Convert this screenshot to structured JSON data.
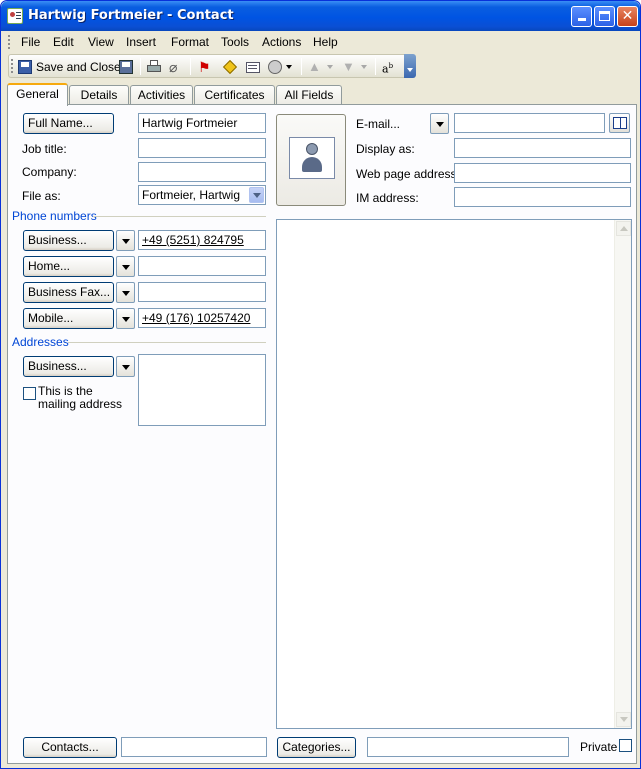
{
  "window": {
    "title": "Hartwig Fortmeier - Contact"
  },
  "menu": {
    "file": "File",
    "edit": "Edit",
    "view": "View",
    "insert": "Insert",
    "format": "Format",
    "tools": "Tools",
    "actions": "Actions",
    "help": "Help"
  },
  "toolbar": {
    "save_close": "Save and Close",
    "icons": [
      "save-icon",
      "print-icon",
      "attach-icon",
      "flag-icon",
      "tag-icon",
      "card-icon",
      "globe-icon",
      "previous-item-icon",
      "next-item-icon",
      "spelling-icon"
    ]
  },
  "tabs": [
    "General",
    "Details",
    "Activities",
    "Certificates",
    "All Fields"
  ],
  "general": {
    "full_name_button": "Full Name...",
    "full_name_value": "Hartwig Fortmeier",
    "job_title_label": "Job title:",
    "job_title_value": "",
    "company_label": "Company:",
    "company_value": "",
    "file_as_label": "File as:",
    "file_as_value": "Fortmeier, Hartwig",
    "phone_group": "Phone numbers",
    "phones": [
      {
        "label": "Business...",
        "value": "+49 (5251) 824795"
      },
      {
        "label": "Home...",
        "value": ""
      },
      {
        "label": "Business Fax...",
        "value": ""
      },
      {
        "label": "Mobile...",
        "value": "+49 (176) 10257420"
      }
    ],
    "address_group": "Addresses",
    "address_button": "Business...",
    "address_value": "",
    "mailing_checkbox_label": "This is the mailing address",
    "mailing_checked": false,
    "email_label": "E-mail...",
    "email_value": "",
    "display_as_label": "Display as:",
    "display_as_value": "",
    "web_page_label": "Web page address:",
    "web_page_value": "",
    "im_label": "IM address:",
    "im_value": "",
    "notes_value": "",
    "contacts_button": "Contacts...",
    "contacts_value": "",
    "categories_button": "Categories...",
    "categories_value": "",
    "private_label": "Private",
    "private_checked": false
  },
  "colors": {
    "title_bar": "#0054e3",
    "group_label": "#0046d5",
    "tab_highlight": "#f6a90e",
    "window_bg": "#ece9d8"
  }
}
